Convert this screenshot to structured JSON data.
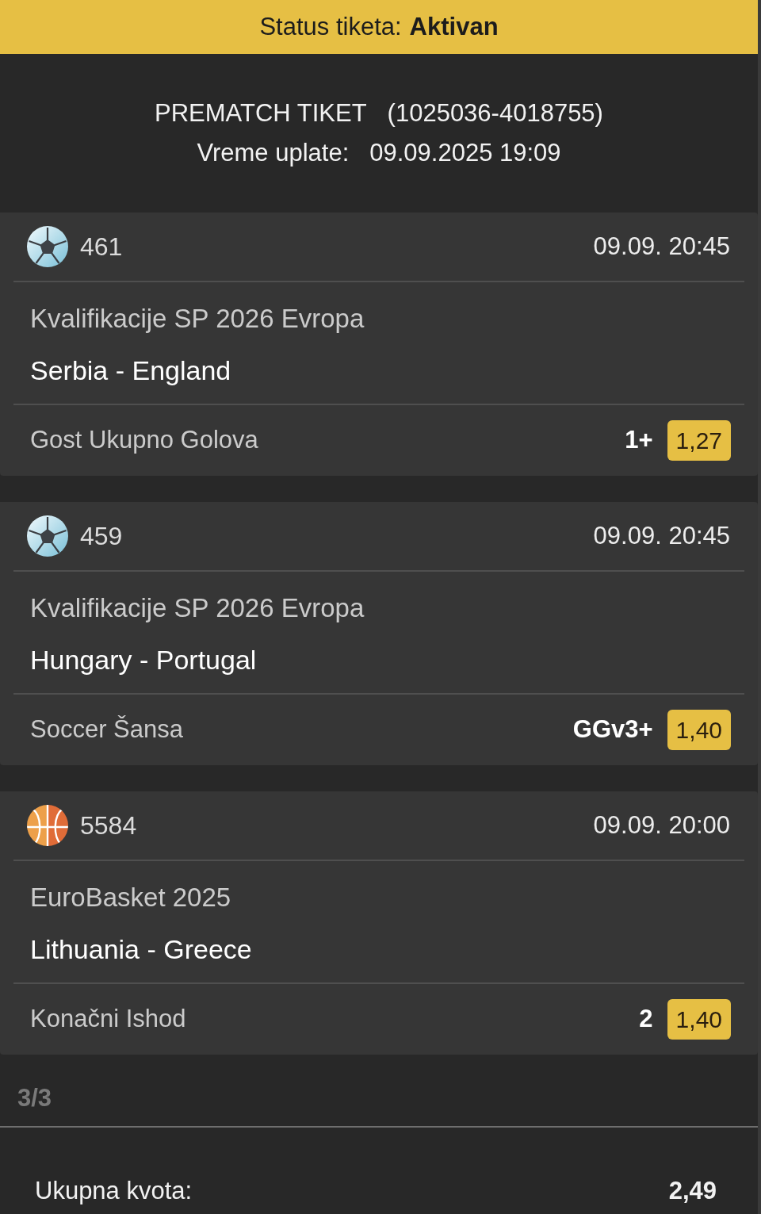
{
  "status_bar": {
    "label": "Status tiketa:",
    "value": "Aktivan"
  },
  "ticket": {
    "type_label": "PREMATCH TIKET",
    "number": "(1025036-4018755)",
    "paid_label": "Vreme uplate:",
    "paid_time": "09.09.2025 19:09"
  },
  "events": [
    {
      "kind": "soccer",
      "code": "461",
      "start": "09.09. 20:45",
      "league": "Kvalifikacije SP 2026 Evropa",
      "match": "Serbia - England",
      "market": "Gost Ukupno Golova",
      "pick": "1+",
      "odds": "1,27"
    },
    {
      "kind": "soccer",
      "code": "459",
      "start": "09.09. 20:45",
      "league": "Kvalifikacije SP 2026 Evropa",
      "match": "Hungary - Portugal",
      "market": "Soccer Šansa",
      "pick": "GGv3+",
      "odds": "1,40"
    },
    {
      "kind": "basketball",
      "code": "5584",
      "start": "09.09. 20:00",
      "league": "EuroBasket 2025",
      "match": "Lithuania - Greece",
      "market": "Konačni Ishod",
      "pick": "2",
      "odds": "1,40"
    }
  ],
  "count": "3/3",
  "total": {
    "label": "Ukupna kvota:",
    "value": "2,49"
  }
}
